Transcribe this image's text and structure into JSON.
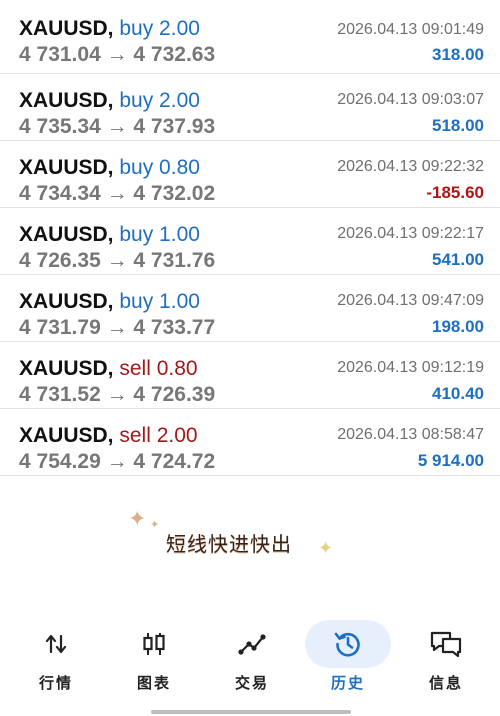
{
  "trades": [
    {
      "symbol": "XAUUSD,",
      "side": "buy 2.00",
      "side_type": "buy",
      "prices": "4 731.04 → 4 732.63",
      "time": "2026.04.13 09:01:49",
      "profit": "318.00",
      "negative": false
    },
    {
      "symbol": "XAUUSD,",
      "side": "buy 2.00",
      "side_type": "buy",
      "prices": "4 735.34 → 4 737.93",
      "time": "2026.04.13 09:03:07",
      "profit": "518.00",
      "negative": false
    },
    {
      "symbol": "XAUUSD,",
      "side": "buy 0.80",
      "side_type": "buy",
      "prices": "4 734.34 → 4 732.02",
      "time": "2026.04.13 09:22:32",
      "profit": "-185.60",
      "negative": true
    },
    {
      "symbol": "XAUUSD,",
      "side": "buy 1.00",
      "side_type": "buy",
      "prices": "4 726.35 → 4 731.76",
      "time": "2026.04.13 09:22:17",
      "profit": "541.00",
      "negative": false
    },
    {
      "symbol": "XAUUSD,",
      "side": "buy 1.00",
      "side_type": "buy",
      "prices": "4 731.79 → 4 733.77",
      "time": "2026.04.13 09:47:09",
      "profit": "198.00",
      "negative": false
    },
    {
      "symbol": "XAUUSD,",
      "side": "sell 0.80",
      "side_type": "sell",
      "prices": "4 731.52 → 4 726.39",
      "time": "2026.04.13 09:12:19",
      "profit": "410.40",
      "negative": false
    },
    {
      "symbol": "XAUUSD,",
      "side": "sell 2.00",
      "side_type": "sell",
      "prices": "4 754.29 → 4 724.72",
      "time": "2026.04.13 08:58:47",
      "profit": "5 914.00",
      "negative": false
    }
  ],
  "promo": {
    "text": "短线快进快出"
  },
  "tabs": [
    {
      "label": "行情",
      "icon": "quotes-arrows-icon",
      "active": false
    },
    {
      "label": "图表",
      "icon": "candlestick-chart-icon",
      "active": false
    },
    {
      "label": "交易",
      "icon": "trade-line-icon",
      "active": false
    },
    {
      "label": "历史",
      "icon": "history-clock-icon",
      "active": true
    },
    {
      "label": "信息",
      "icon": "messages-icon",
      "active": false
    }
  ],
  "colors": {
    "buy": "#1e6fc4",
    "sell": "#a31818",
    "positive_profit": "#1e6fc4",
    "negative_profit": "#b01515",
    "active_tab": "#1e6fc4"
  }
}
